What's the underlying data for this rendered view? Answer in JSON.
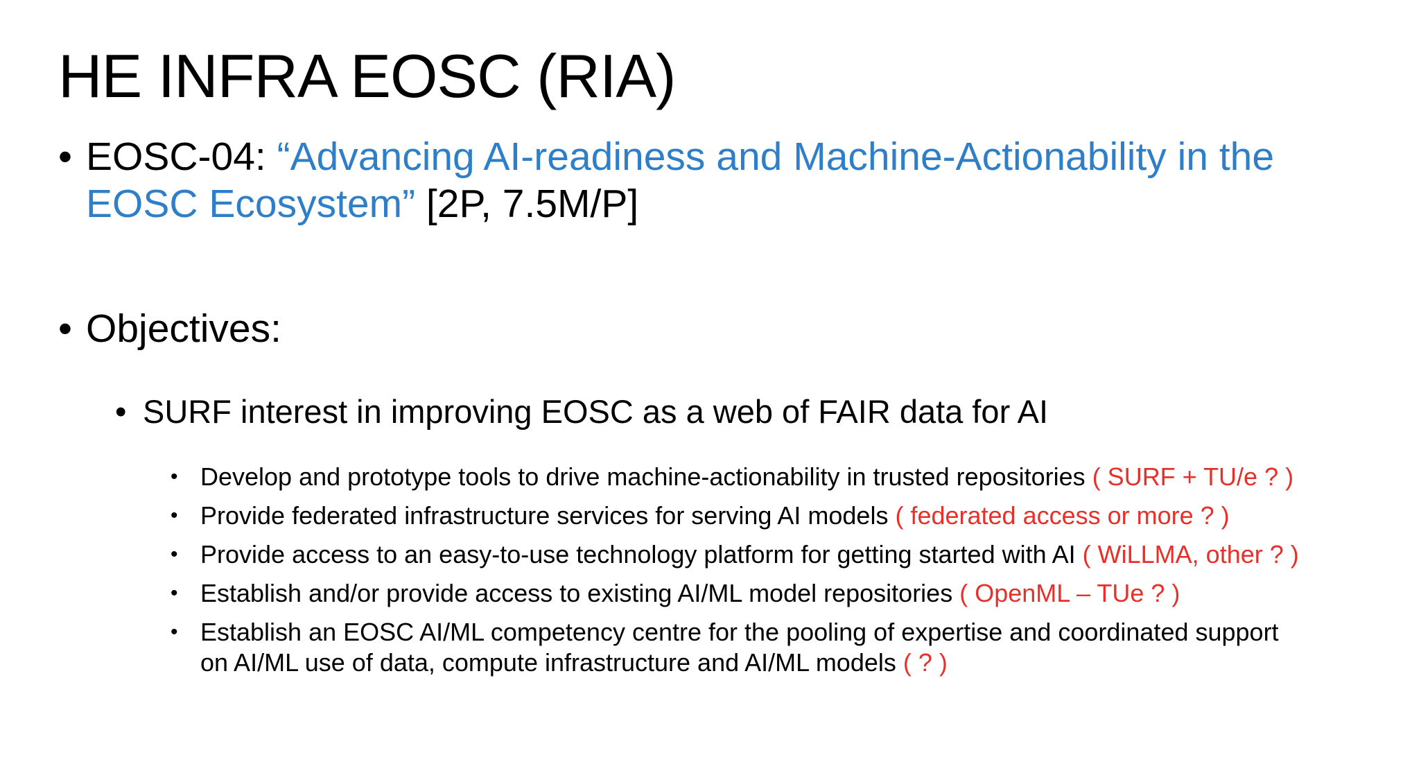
{
  "slide": {
    "title": "HE INFRA EOSC (RIA)",
    "bullet_char": "•",
    "eosc_item": {
      "code": "EOSC-04: ",
      "quoted_title_line1": "“Advancing AI-readiness and Machine-Actionability in the",
      "quoted_title_line2": "EOSC Ecosystem”",
      "budget": " [2P, 7.5M/P]"
    },
    "objectives": {
      "label": "Objectives:",
      "sub_item": "SURF interest in improving EOSC as a web of FAIR data for AI",
      "details": [
        {
          "text": "Develop and prototype tools to drive machine-actionability in trusted repositories ",
          "note": "( SURF + TU/e ? )"
        },
        {
          "text": "Provide federated infrastructure services for serving AI models ",
          "note": "( federated access or more ? )"
        },
        {
          "text": "Provide access to an easy-to-use technology platform for getting started with AI ",
          "note": "( WiLLMA, other ? )"
        },
        {
          "text": "Establish and/or provide access to existing AI/ML model repositories ",
          "note": "( OpenML – TUe ? )"
        },
        {
          "text_line1": "Establish an EOSC AI/ML competency centre for the pooling of expertise and coordinated support",
          "text_line2": "on AI/ML use of data, compute infrastructure and AI/ML models ",
          "note": "( ? )"
        }
      ]
    },
    "colors": {
      "accent_blue": "#2f7fc8",
      "note_red": "#e8302a",
      "text": "#000000",
      "background": "#ffffff"
    }
  }
}
